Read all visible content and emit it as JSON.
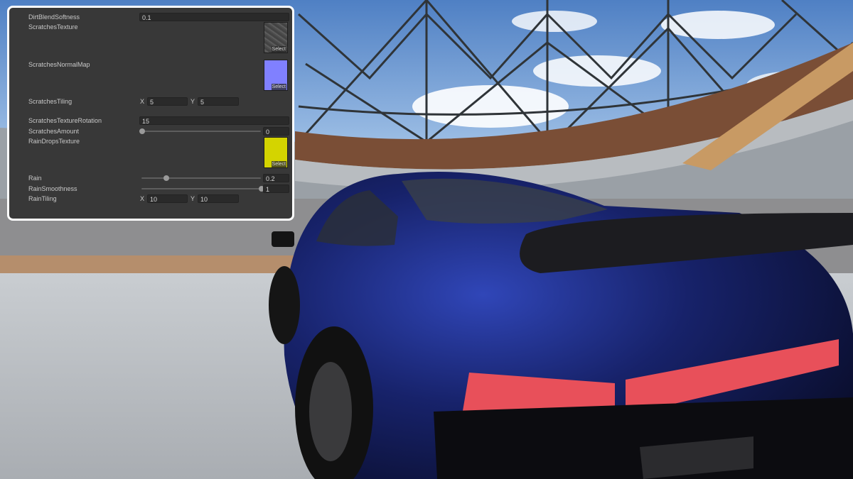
{
  "inspector": {
    "dirt_blend_softness": {
      "label": "DirtBlendSoftness",
      "value": "0.1"
    },
    "scratches_texture": {
      "label": "ScratchesTexture",
      "select_label": "Select",
      "icon": "scratches-texture-thumbnail"
    },
    "scratches_normal_map": {
      "label": "ScratchesNormalMap",
      "select_label": "Select",
      "icon": "normal-map-thumbnail",
      "color": "#8080ff"
    },
    "scratches_tiling": {
      "label": "ScratchesTiling",
      "x_label": "X",
      "x_value": "5",
      "y_label": "Y",
      "y_value": "5"
    },
    "scratches_texture_rotation": {
      "label": "ScratchesTextureRotation",
      "value": "15"
    },
    "scratches_amount": {
      "label": "ScratchesAmount",
      "value": "0",
      "fraction": 0
    },
    "rain_drops_texture": {
      "label": "RainDropsTexture",
      "select_label": "Select",
      "icon": "raindrops-texture-thumbnail",
      "color": "#d4d400"
    },
    "rain": {
      "label": "Rain",
      "value": "0.2",
      "fraction": 0.2
    },
    "rain_smoothness": {
      "label": "RainSmoothness",
      "value": "1",
      "fraction": 1
    },
    "rain_tiling": {
      "label": "RainTiling",
      "x_label": "X",
      "x_value": "10",
      "y_label": "Y",
      "y_value": "10"
    }
  },
  "colors": {
    "panel_bg": "#383838",
    "panel_border": "#ffffff",
    "field_bg": "#2a2a2a",
    "car_paint": "#141c5a",
    "tail_light": "#e8505a"
  }
}
